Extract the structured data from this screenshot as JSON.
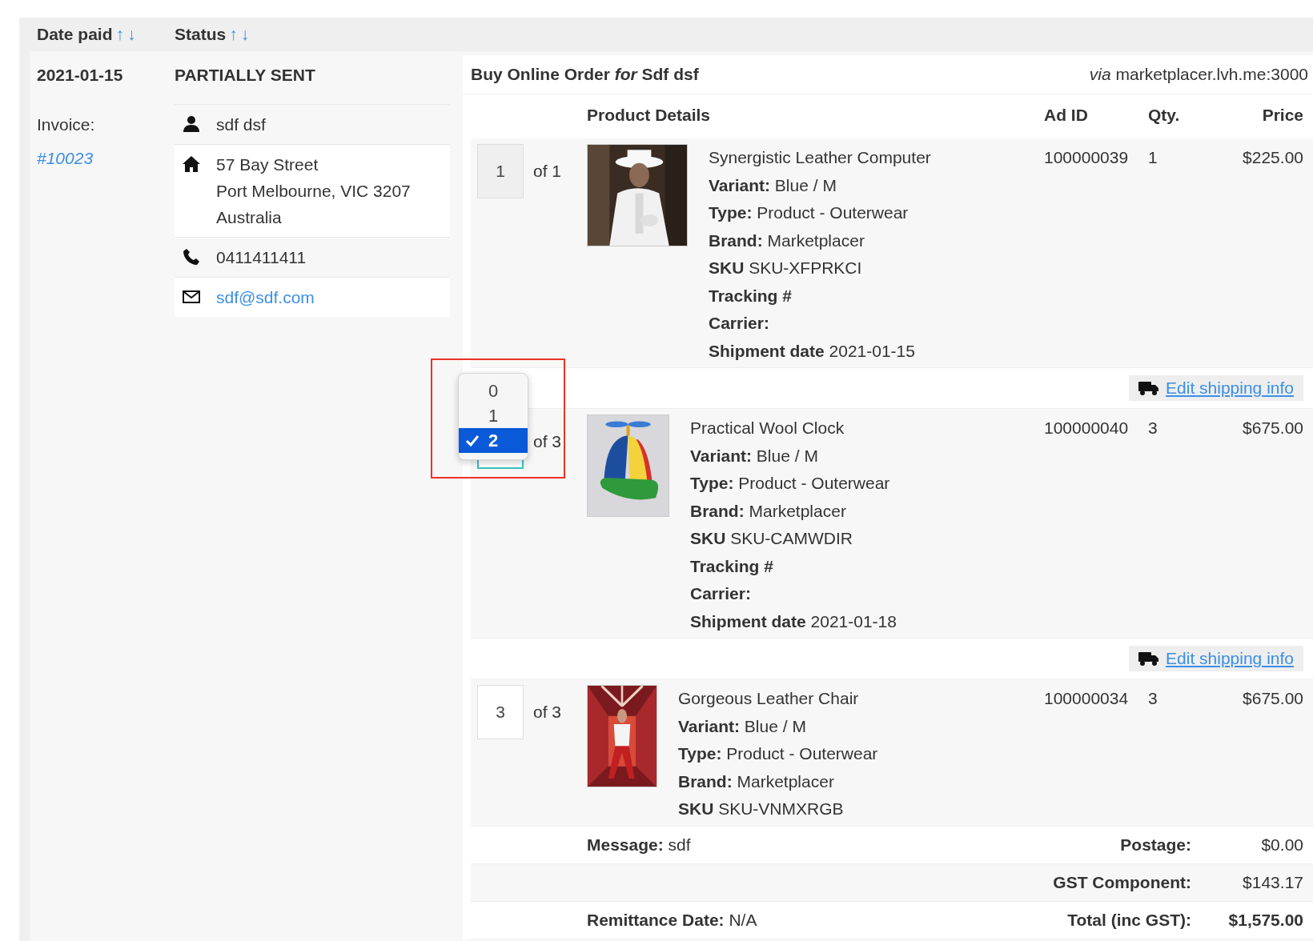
{
  "columns": [
    {
      "label": "Date paid",
      "arrows": [
        "↑",
        "↓"
      ]
    },
    {
      "label": "Status",
      "arrows": [
        "↑",
        "↓"
      ]
    }
  ],
  "order": {
    "date": "2021-01-15",
    "status": "PARTIALLY SENT",
    "invoice_label": "Invoice:",
    "invoice_link": "#10023",
    "contact": [
      {
        "kind": "person",
        "lines": [
          "sdf dsf"
        ]
      },
      {
        "kind": "home",
        "lines": [
          "57 Bay Street",
          "Port Melbourne, VIC 3207",
          "Australia"
        ]
      },
      {
        "kind": "phone",
        "lines": [
          "0411411411"
        ]
      },
      {
        "kind": "email",
        "lines": [
          "sdf@sdf.com"
        ]
      }
    ]
  },
  "panel": {
    "title": "Buy Online Order *for* Sdf dsf",
    "via": "*via* marketplacer.lvh.me:3000",
    "headers": [
      "Product Details",
      "Ad ID",
      "Qty.",
      "Price"
    ],
    "rows": [
      {
        "kind": "item",
        "qty": {
          "value": "1",
          "disabled": true,
          "focused": false
        },
        "of": "of 1",
        "picture": {
          "kind": "picture"
        },
        "name": "Synergistic Leather Computer",
        "lines": [
          "**Variant:** Blue / M",
          "**Type:** Product - Outerwear",
          "**Brand:** Marketplacer",
          "**SKU** SKU-XFPRKCI",
          "**Tracking #**",
          "**Carrier:**",
          "**Shipment date** 2021-01-15"
        ],
        "ad_id": "100000039",
        "quantity": "1",
        "price": "$225.00"
      },
      {
        "kind": "shipping",
        "label": "Edit shipping info"
      },
      {
        "kind": "item",
        "qty": {
          "disabled": false,
          "focused": true
        },
        "of": "of 3",
        "dropdown": {
          "options": [
            {
              "label": "0",
              "selected": false
            },
            {
              "label": "1",
              "selected": false
            },
            {
              "label": "2",
              "selected": true
            }
          ]
        },
        "picture": {
          "kind": "picture"
        },
        "name": "Practical Wool Clock",
        "lines": [
          "**Variant:** Blue / M",
          "**Type:** Product - Outerwear",
          "**Brand:** Marketplacer",
          "**SKU** SKU-CAMWDIR",
          "**Tracking #**",
          "**Carrier:**",
          "**Shipment date** 2021-01-18"
        ],
        "ad_id": "100000040",
        "quantity": "3",
        "price": "$675.00"
      },
      {
        "kind": "shipping",
        "label": "Edit shipping info"
      },
      {
        "kind": "item",
        "qty": {
          "value": "3",
          "disabled": false,
          "focused": false
        },
        "of": "of 3",
        "picture": {
          "kind": "picture"
        },
        "name": "Gorgeous Leather Chair",
        "lines": [
          "**Variant:** Blue / M",
          "**Type:** Product - Outerwear",
          "**Brand:** Marketplacer",
          "**SKU** SKU-VNMXRGB"
        ],
        "ad_id": "100000034",
        "quantity": "3",
        "price": "$675.00"
      }
    ],
    "summary": [
      {
        "left": "**Message:** sdf",
        "label": "Postage:",
        "amount": "$0.00",
        "bold": false
      },
      {
        "label": "GST Component:",
        "amount": "$143.17",
        "bold": false
      },
      {
        "left": "**Remittance Date:** N/A",
        "label": "Total (inc GST):",
        "amount": "$1,575.00",
        "bold": true
      }
    ]
  }
}
